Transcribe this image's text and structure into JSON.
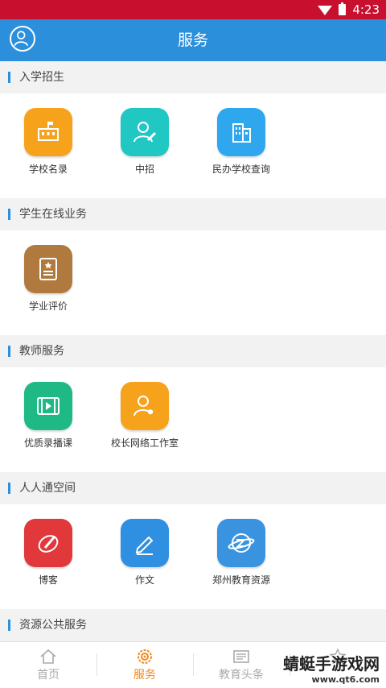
{
  "status_bar": {
    "time": "4:23"
  },
  "header": {
    "title": "服务"
  },
  "sections": [
    {
      "title": "入学招生",
      "items": [
        {
          "label": "学校名录",
          "icon": "school-icon",
          "color": "#f7a21b"
        },
        {
          "label": "中招",
          "icon": "user-edit-icon",
          "color": "#21c7c3"
        },
        {
          "label": "民办学校查询",
          "icon": "building-icon",
          "color": "#2ea7ee"
        }
      ]
    },
    {
      "title": "学生在线业务",
      "items": [
        {
          "label": "学业评价",
          "icon": "certificate-icon",
          "color": "#b07a3e"
        }
      ]
    },
    {
      "title": "教师服务",
      "items": [
        {
          "label": "优质录播课",
          "icon": "video-icon",
          "color": "#1fb986"
        },
        {
          "label": "校长网络工作室",
          "icon": "principal-icon",
          "color": "#f7a21b"
        }
      ]
    },
    {
      "title": "人人通空间",
      "items": [
        {
          "label": "博客",
          "icon": "blog-icon",
          "color": "#e0383b"
        },
        {
          "label": "作文",
          "icon": "pencil-icon",
          "color": "#2f8fe0"
        },
        {
          "label": "郑州教育资源",
          "icon": "globe-icon",
          "color": "#3a93de"
        }
      ]
    },
    {
      "title": "资源公共服务",
      "items": []
    }
  ],
  "tabs": [
    {
      "label": "首页",
      "icon": "home-icon"
    },
    {
      "label": "服务",
      "icon": "service-icon",
      "active": true
    },
    {
      "label": "教育头条",
      "icon": "news-icon"
    },
    {
      "label": "",
      "icon": "star-icon"
    }
  ],
  "watermark": {
    "text": "蜻蜓手游戏网",
    "url": "www.qt6.com"
  }
}
